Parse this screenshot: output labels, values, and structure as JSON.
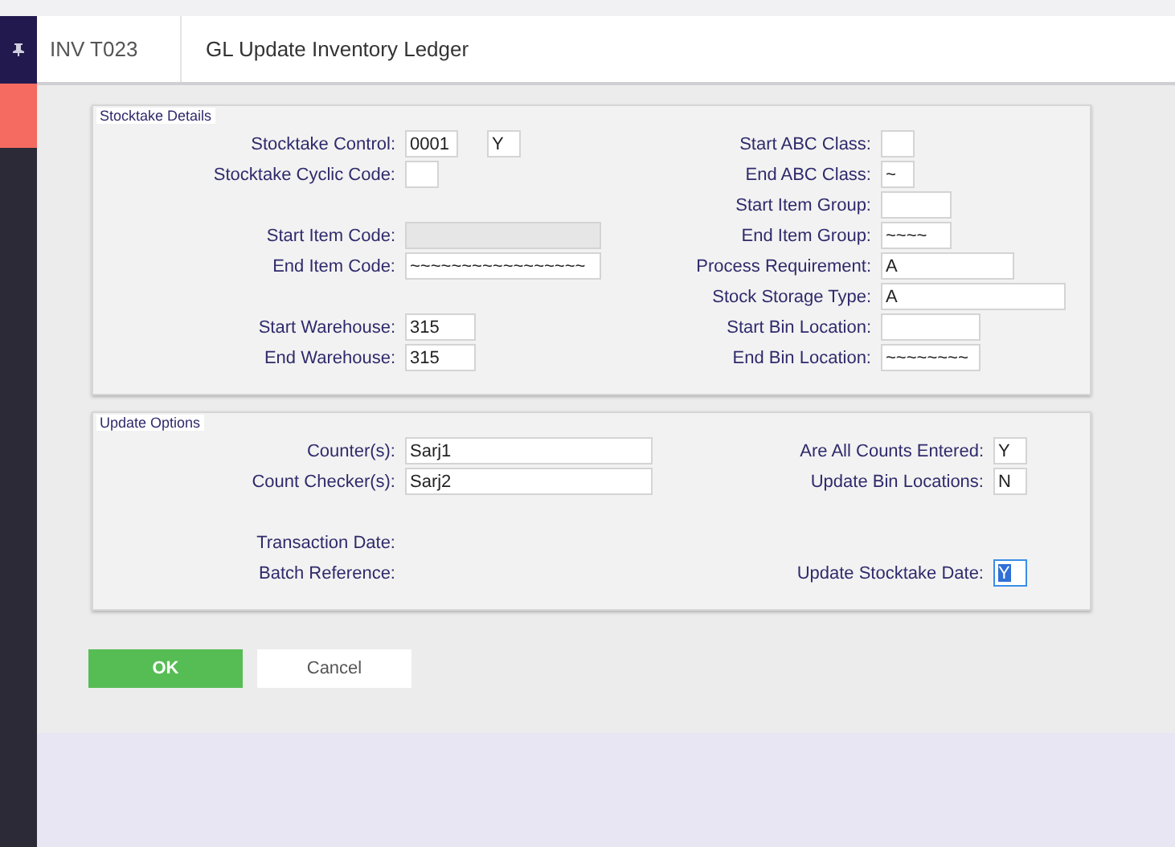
{
  "header": {
    "code": "INV T023",
    "title": "GL Update Inventory Ledger"
  },
  "sections": [
    {
      "title": "Stocktake Details",
      "columns": [
        {
          "groups": [
            [
              {
                "label": "Stocktake Control:",
                "inputs": [
                  {
                    "kind": "field",
                    "value": "0001"
                  },
                  {
                    "kind": "field",
                    "value": "Y"
                  }
                ]
              },
              {
                "label": "Stocktake Cyclic Code:",
                "inputs": [
                  {
                    "kind": "field"
                  }
                ]
              }
            ],
            [
              {
                "label": "Start Item Code:",
                "inputs": [
                  {
                    "kind": "field",
                    "disabled": true
                  }
                ]
              },
              {
                "label": "End Item Code:",
                "inputs": [
                  {
                    "kind": "field",
                    "value": "~~~~~~~~~~~~~~~~~"
                  }
                ]
              }
            ],
            [
              {
                "label": "Start Warehouse:",
                "inputs": [
                  {
                    "kind": "field",
                    "value": "315"
                  }
                ]
              },
              {
                "label": "End Warehouse:",
                "inputs": [
                  {
                    "kind": "field",
                    "value": "315"
                  }
                ]
              }
            ]
          ]
        },
        {
          "groups": [
            [
              {
                "label": "Start ABC Class:",
                "inputs": [
                  {
                    "kind": "field"
                  }
                ]
              },
              {
                "label": "End ABC Class:",
                "inputs": [
                  {
                    "kind": "field",
                    "value": "~"
                  }
                ]
              },
              {
                "label": "Start Item Group:",
                "inputs": [
                  {
                    "kind": "field"
                  }
                ]
              },
              {
                "label": "End Item Group:",
                "inputs": [
                  {
                    "kind": "field",
                    "value": "~~~~"
                  }
                ]
              },
              {
                "label": "Process Requirement:",
                "inputs": [
                  {
                    "kind": "field",
                    "value": "A"
                  }
                ]
              },
              {
                "label": "Stock Storage Type:",
                "inputs": [
                  {
                    "kind": "field",
                    "value": "A"
                  }
                ]
              },
              {
                "label": "Start Bin Location:",
                "inputs": [
                  {
                    "kind": "field"
                  }
                ]
              },
              {
                "label": "End Bin Location:",
                "inputs": [
                  {
                    "kind": "field",
                    "value": "~~~~~~~~"
                  }
                ]
              }
            ]
          ]
        }
      ]
    },
    {
      "title": "Update Options",
      "columns": [
        {
          "groups": [
            [
              {
                "label": "Counter(s):",
                "inputs": [
                  {
                    "kind": "field",
                    "value": "Sarj1"
                  }
                ]
              },
              {
                "label": "Count Checker(s):",
                "inputs": [
                  {
                    "kind": "field",
                    "value": "Sarj2"
                  }
                ]
              }
            ],
            [
              {
                "label": "Transaction Date:"
              },
              {
                "label": "Batch Reference:"
              }
            ]
          ]
        },
        {
          "groups": [
            [
              {
                "label": "Are All Counts Entered:",
                "inputs": [
                  {
                    "kind": "field",
                    "value": "Y"
                  }
                ]
              },
              {
                "label": "Update Bin Locations:",
                "inputs": [
                  {
                    "kind": "field",
                    "value": "N"
                  }
                ]
              }
            ],
            [
              {
                "label": "Update Stocktake Date:",
                "inputs": [
                  {
                    "kind": "field",
                    "value": "Y",
                    "focused": true
                  }
                ]
              }
            ]
          ]
        }
      ]
    }
  ],
  "buttons": [
    {
      "label": "OK",
      "kind": "primary"
    },
    {
      "label": "Cancel",
      "kind": "secondary"
    }
  ]
}
